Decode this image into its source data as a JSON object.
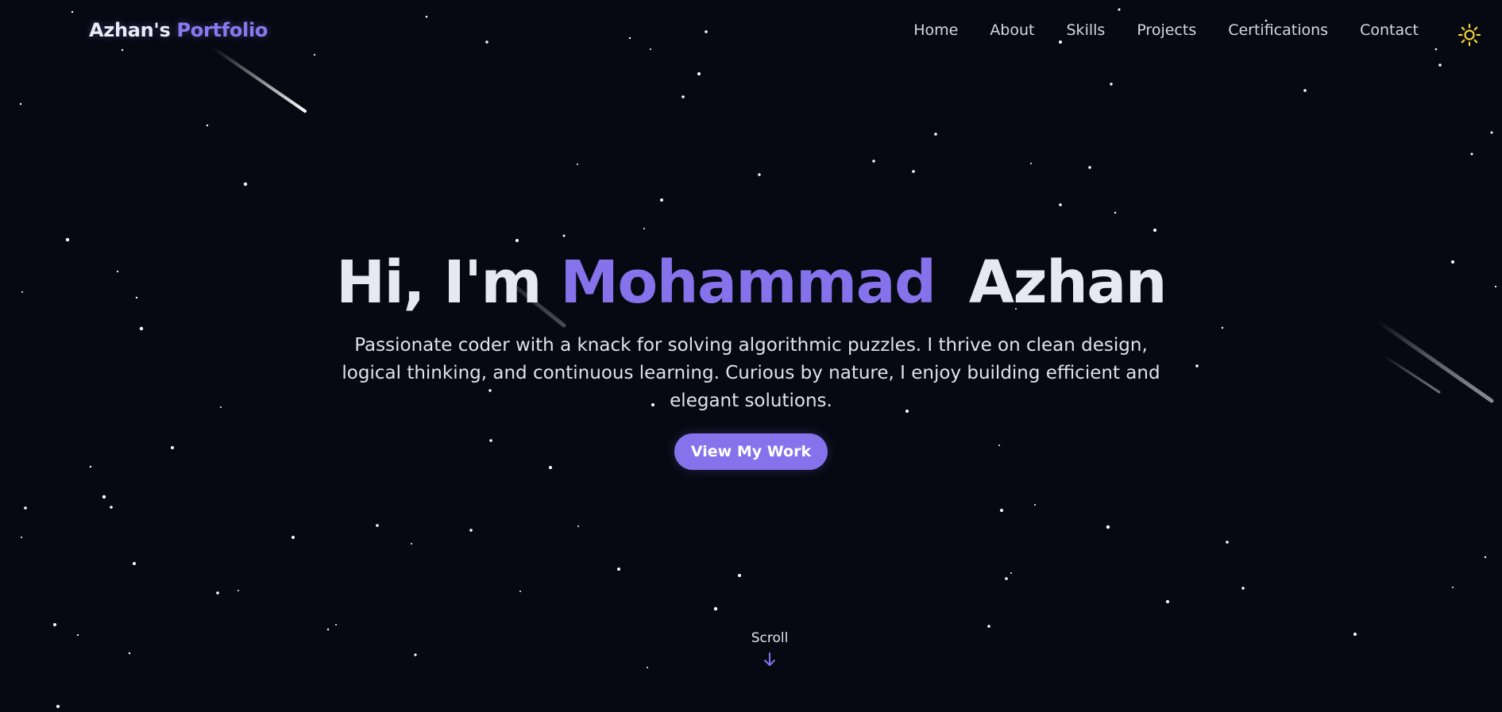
{
  "brand": {
    "name_part1": "Azhan's",
    "name_part2": "Portfolio"
  },
  "nav": {
    "items": [
      {
        "id": "home",
        "label": "Home"
      },
      {
        "id": "about",
        "label": "About"
      },
      {
        "id": "skills",
        "label": "Skills"
      },
      {
        "id": "projects",
        "label": "Projects"
      },
      {
        "id": "certifications",
        "label": "Certifications"
      },
      {
        "id": "contact",
        "label": "Contact"
      }
    ],
    "theme_toggle_icon": "sun-icon"
  },
  "hero": {
    "greeting": "Hi, I'm",
    "highlight_name": "Mohammad",
    "last_name": "Azhan",
    "description": "Passionate coder with a knack for solving algorithmic puzzles. I thrive on clean design, logical thinking, and continuous learning. Curious by nature, I enjoy building efficient and elegant solutions.",
    "cta_label": "View My Work"
  },
  "scroll": {
    "label": "Scroll",
    "icon": "arrow-down-icon"
  },
  "colors": {
    "background": "#060912",
    "accent": "#8672ea",
    "text": "#e6e9f2",
    "sun": "#f5d33a"
  }
}
